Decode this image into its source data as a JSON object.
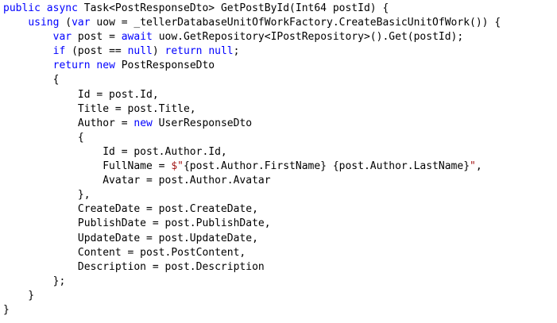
{
  "colors": {
    "keyword": "#0000ff",
    "string": "#a31515",
    "plain": "#000000",
    "background": "#ffffff"
  },
  "code": {
    "lines": [
      [
        {
          "t": "k",
          "v": "public"
        },
        {
          "t": "p",
          "v": " "
        },
        {
          "t": "k",
          "v": "async"
        },
        {
          "t": "p",
          "v": " Task<PostResponseDto> GetPostById(Int64 postId) {"
        }
      ],
      [
        {
          "t": "p",
          "v": "    "
        },
        {
          "t": "k",
          "v": "using"
        },
        {
          "t": "p",
          "v": " ("
        },
        {
          "t": "k",
          "v": "var"
        },
        {
          "t": "p",
          "v": " uow = _tellerDatabaseUnitOfWorkFactory.CreateBasicUnitOfWork()) {"
        }
      ],
      [
        {
          "t": "p",
          "v": "        "
        },
        {
          "t": "k",
          "v": "var"
        },
        {
          "t": "p",
          "v": " post = "
        },
        {
          "t": "k",
          "v": "await"
        },
        {
          "t": "p",
          "v": " uow.GetRepository<IPostRepository>().Get(postId);"
        }
      ],
      [
        {
          "t": "p",
          "v": "        "
        },
        {
          "t": "k",
          "v": "if"
        },
        {
          "t": "p",
          "v": " (post == "
        },
        {
          "t": "k",
          "v": "null"
        },
        {
          "t": "p",
          "v": ") "
        },
        {
          "t": "k",
          "v": "return"
        },
        {
          "t": "p",
          "v": " "
        },
        {
          "t": "k",
          "v": "null"
        },
        {
          "t": "p",
          "v": ";"
        }
      ],
      [
        {
          "t": "p",
          "v": "        "
        },
        {
          "t": "k",
          "v": "return"
        },
        {
          "t": "p",
          "v": " "
        },
        {
          "t": "k",
          "v": "new"
        },
        {
          "t": "p",
          "v": " PostResponseDto"
        }
      ],
      [
        {
          "t": "p",
          "v": "        {"
        }
      ],
      [
        {
          "t": "p",
          "v": "            Id = post.Id,"
        }
      ],
      [
        {
          "t": "p",
          "v": "            Title = post.Title,"
        }
      ],
      [
        {
          "t": "p",
          "v": "            Author = "
        },
        {
          "t": "k",
          "v": "new"
        },
        {
          "t": "p",
          "v": " UserResponseDto"
        }
      ],
      [
        {
          "t": "p",
          "v": "            {"
        }
      ],
      [
        {
          "t": "p",
          "v": "                Id = post.Author.Id,"
        }
      ],
      [
        {
          "t": "p",
          "v": "                FullName = "
        },
        {
          "t": "s",
          "v": "$\""
        },
        {
          "t": "p",
          "v": "{post.Author.FirstName}"
        },
        {
          "t": "s",
          "v": " "
        },
        {
          "t": "p",
          "v": "{post.Author.LastName}"
        },
        {
          "t": "s",
          "v": "\""
        },
        {
          "t": "p",
          "v": ","
        }
      ],
      [
        {
          "t": "p",
          "v": "                Avatar = post.Author.Avatar"
        }
      ],
      [
        {
          "t": "p",
          "v": "            },"
        }
      ],
      [
        {
          "t": "p",
          "v": "            CreateDate = post.CreateDate,"
        }
      ],
      [
        {
          "t": "p",
          "v": "            PublishDate = post.PublishDate,"
        }
      ],
      [
        {
          "t": "p",
          "v": "            UpdateDate = post.UpdateDate,"
        }
      ],
      [
        {
          "t": "p",
          "v": "            Content = post.PostContent,"
        }
      ],
      [
        {
          "t": "p",
          "v": "            Description = post.Description"
        }
      ],
      [
        {
          "t": "p",
          "v": "        };"
        }
      ],
      [
        {
          "t": "p",
          "v": "    }"
        }
      ],
      [
        {
          "t": "p",
          "v": "}"
        }
      ]
    ]
  }
}
